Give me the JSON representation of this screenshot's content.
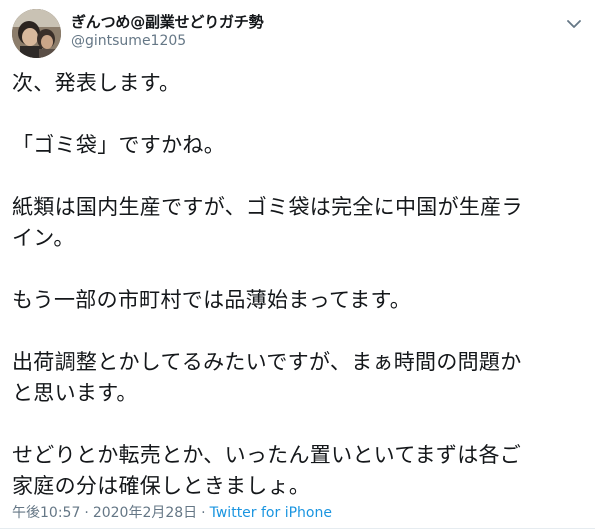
{
  "author": {
    "name": "ぎんつめ@副業せどりガチ勢",
    "handle": "@gintsume1205"
  },
  "icons": {
    "avatar": "profile-photo",
    "menu": "chevron-down-icon"
  },
  "tweet": {
    "p1": "次、発表します。",
    "p2": "「ゴミ袋」ですかね。",
    "p3a": "紙類は国内生産ですが、ゴミ袋は完全に中国が生産ラ",
    "p3b": "イン。",
    "p4": "もう一部の市町村では品薄始まってます。",
    "p5a": "出荷調整とかしてるみたいですが、まぁ時間の問題か",
    "p5b": "と思います。",
    "p6a": "せどりとか転売とか、いったん置いといてまずは各ご",
    "p6b": "家庭の分は確保しときましょ。"
  },
  "meta": {
    "time": "午後10:57",
    "separator": "·",
    "date": "2020年2月28日",
    "source": "Twitter for iPhone"
  },
  "colors": {
    "text": "#14171a",
    "muted": "#657786",
    "link": "#1b95e0"
  }
}
